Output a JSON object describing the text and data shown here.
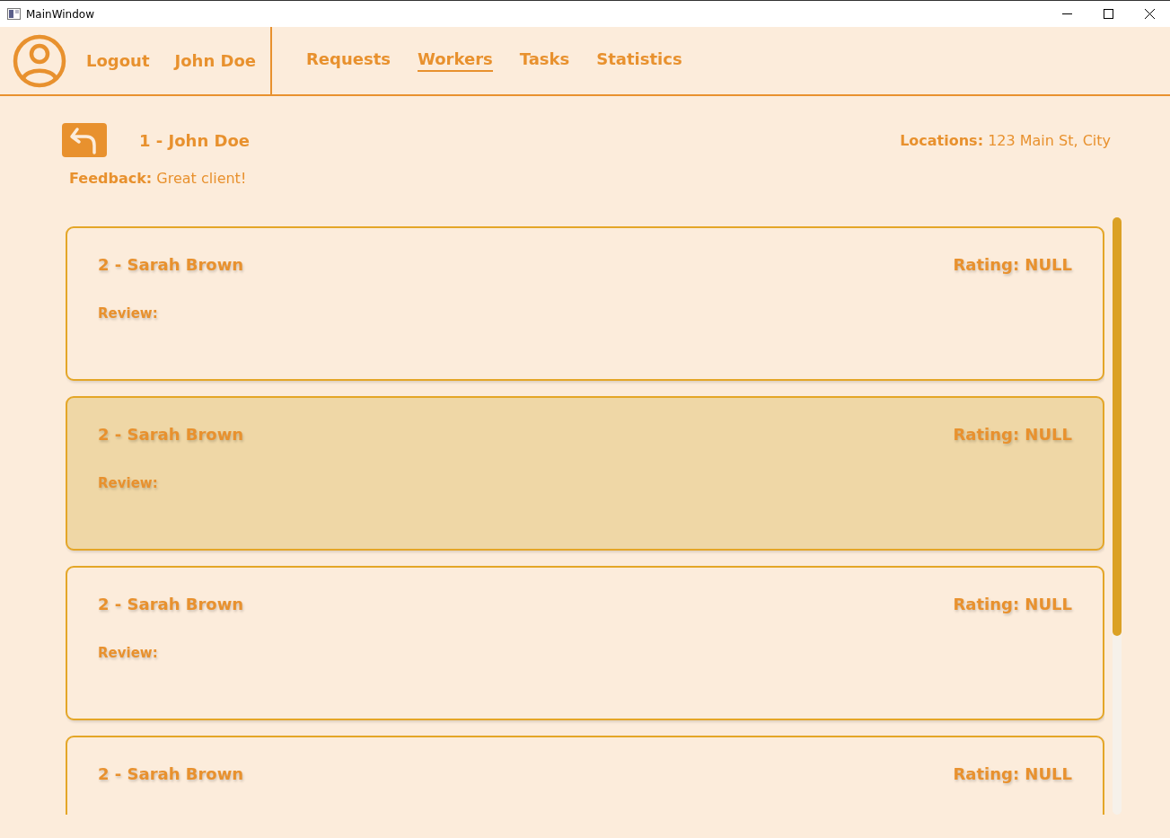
{
  "window": {
    "title": "MainWindow"
  },
  "header": {
    "user_links": [
      "Logout",
      "John Doe"
    ],
    "tabs": [
      {
        "label": "Requests",
        "selected": false
      },
      {
        "label": "Workers",
        "selected": true
      },
      {
        "label": "Tasks",
        "selected": false
      },
      {
        "label": "Statistics",
        "selected": false
      }
    ]
  },
  "client": {
    "title": "1 - John Doe",
    "locations_label": "Locations:",
    "locations": "123 Main St, City",
    "feedback_label": "Feedback:",
    "feedback": "Great client!"
  },
  "reviews": [
    {
      "name": "2 - Sarah Brown",
      "rating": "Rating: NULL",
      "review": "Review:",
      "selected": false
    },
    {
      "name": "2 - Sarah Brown",
      "rating": "Rating: NULL",
      "review": "Review:",
      "selected": true
    },
    {
      "name": "2 - Sarah Brown",
      "rating": "Rating: NULL",
      "review": "Review:",
      "selected": false
    },
    {
      "name": "2 - Sarah Brown",
      "rating": "Rating: NULL",
      "selected": false
    }
  ]
}
